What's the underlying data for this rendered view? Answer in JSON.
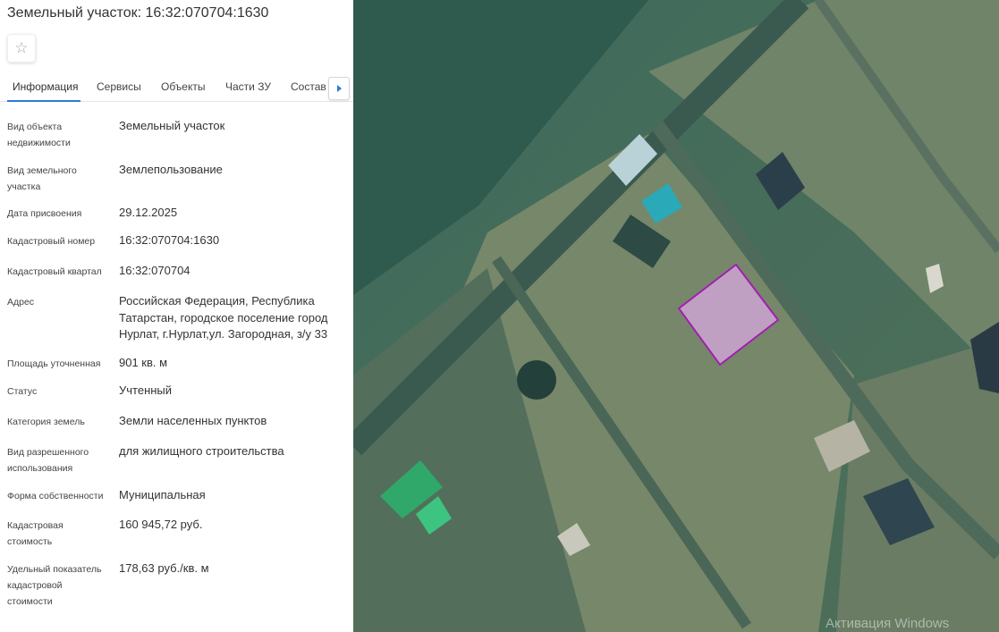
{
  "header": {
    "title": "Земельный участок: 16:32:070704:1630",
    "favorite_icon": "star-outline-icon"
  },
  "tabs": [
    "Информация",
    "Сервисы",
    "Объекты",
    "Части ЗУ",
    "Состав"
  ],
  "active_tab": "Информация",
  "info": [
    {
      "label": "Вид объекта недвижимости",
      "value": "Земельный участок"
    },
    {
      "label": "Вид земельного участка",
      "value": "Землепользование"
    },
    {
      "label": "Дата присвоения",
      "value": "29.12.2025"
    },
    {
      "label": "Кадастровый номер",
      "value": "16:32:070704:1630"
    },
    {
      "label": "Кадастровый квартал",
      "value": "16:32:070704"
    },
    {
      "label": "Адрес",
      "value": "Российская Федерация, Республика Татарстан, городское поселение город Нурлат, г.Нурлат,ул. Загородная, з/у 33"
    },
    {
      "label": "Площадь уточненная",
      "value": "901 кв. м"
    },
    {
      "label": "Статус",
      "value": "Учтенный"
    },
    {
      "label": "Категория земель",
      "value": "Земли населенных пунктов"
    },
    {
      "label": "Вид разрешенного использования",
      "value": "для жилищного строительства"
    },
    {
      "label": "Форма собственности",
      "value": "Муниципальная"
    },
    {
      "label": "Кадастровая стоимость",
      "value": "160 945,72 руб."
    },
    {
      "label": "Удельный показатель кадастровой стоимости",
      "value": "178,63 руб./кв. м"
    }
  ],
  "map": {
    "parcel_color": "#a020b0",
    "parcel_fill": "#d8a8e0",
    "watermark": "Активация Windows"
  }
}
